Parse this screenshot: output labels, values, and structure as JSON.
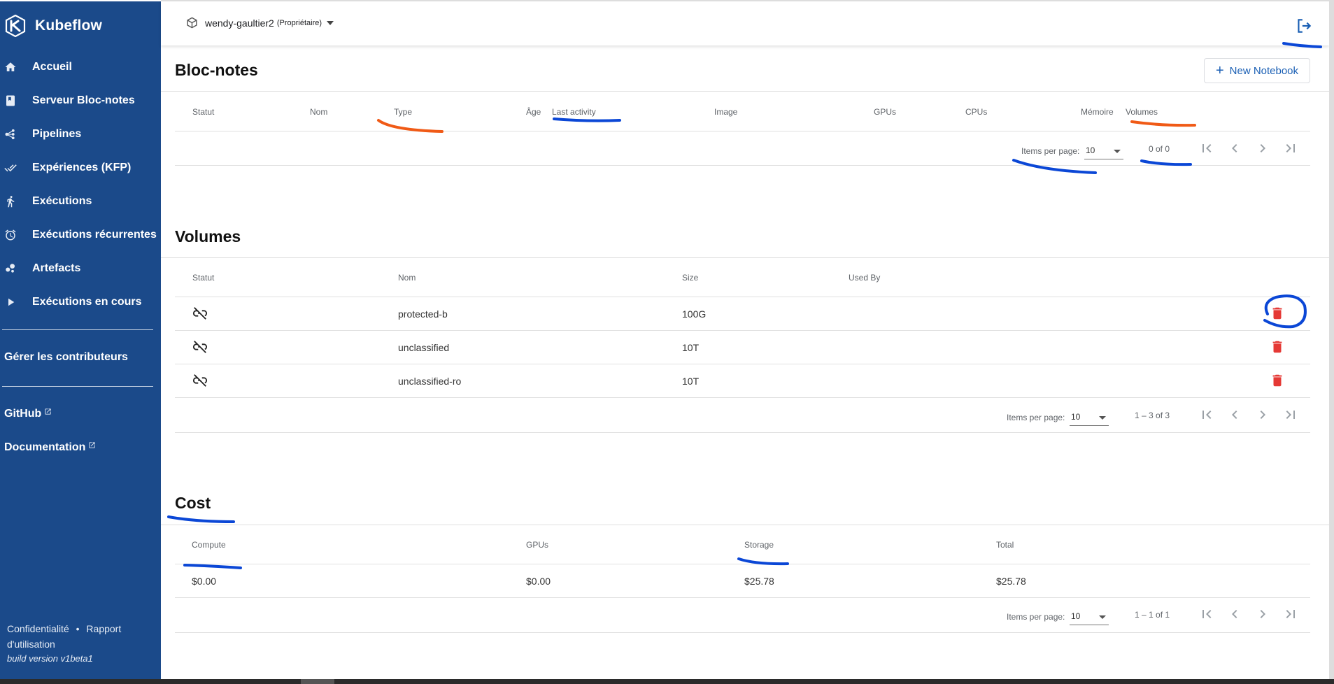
{
  "brand": {
    "name": "Kubeflow"
  },
  "sidebar": {
    "items": [
      {
        "label": "Accueil",
        "icon": "home-icon"
      },
      {
        "label": "Serveur Bloc-notes",
        "icon": "notebook-icon"
      },
      {
        "label": "Pipelines",
        "icon": "pipeline-icon"
      },
      {
        "label": "Expériences (KFP)",
        "icon": "done-all-icon"
      },
      {
        "label": "Exécutions",
        "icon": "run-icon"
      },
      {
        "label": "Exécutions récurrentes",
        "icon": "alarm-icon"
      },
      {
        "label": "Artefacts",
        "icon": "bubble-chart-icon"
      },
      {
        "label": "Exécutions en cours",
        "icon": "play-arrow-icon"
      }
    ],
    "manage_contributors": "Gérer les contributeurs",
    "github": "GitHub",
    "documentation": "Documentation",
    "privacy": "Confidentialité",
    "bullet": "•",
    "usage_report": "Rapport d'utilisation",
    "build": "build version v1beta1"
  },
  "topbar": {
    "namespace": "wendy-gaultier2",
    "role": "(Propriétaire)"
  },
  "notebooks": {
    "title": "Bloc-notes",
    "new_button": "New Notebook",
    "columns": [
      "Statut",
      "Nom",
      "Type",
      "Âge",
      "Last activity",
      "Image",
      "GPUs",
      "CPUs",
      "Mémoire",
      "Volumes"
    ],
    "pagination": {
      "label": "Items per page:",
      "per_page": "10",
      "range": "0 of 0"
    }
  },
  "volumes": {
    "title": "Volumes",
    "columns": [
      "Statut",
      "Nom",
      "Size",
      "Used By"
    ],
    "rows": [
      {
        "name": "protected-b",
        "size": "100G",
        "used_by": ""
      },
      {
        "name": "unclassified",
        "size": "10T",
        "used_by": ""
      },
      {
        "name": "unclassified-ro",
        "size": "10T",
        "used_by": ""
      }
    ],
    "pagination": {
      "label": "Items per page:",
      "per_page": "10",
      "range": "1 – 3 of 3"
    }
  },
  "cost": {
    "title": "Cost",
    "columns": [
      "Compute",
      "GPUs",
      "Storage",
      "Total"
    ],
    "row": {
      "compute": "$0.00",
      "gpus": "$0.00",
      "storage": "$25.78",
      "total": "$25.78"
    },
    "pagination": {
      "label": "Items per page:",
      "per_page": "10",
      "range": "1 – 1 of 1"
    }
  },
  "colors": {
    "sidebar_bg": "#1b4a8a",
    "accent": "#1a5fb4",
    "delete": "#e53935",
    "annotation_blue": "#0b47d6",
    "annotation_orange": "#f05a16"
  }
}
